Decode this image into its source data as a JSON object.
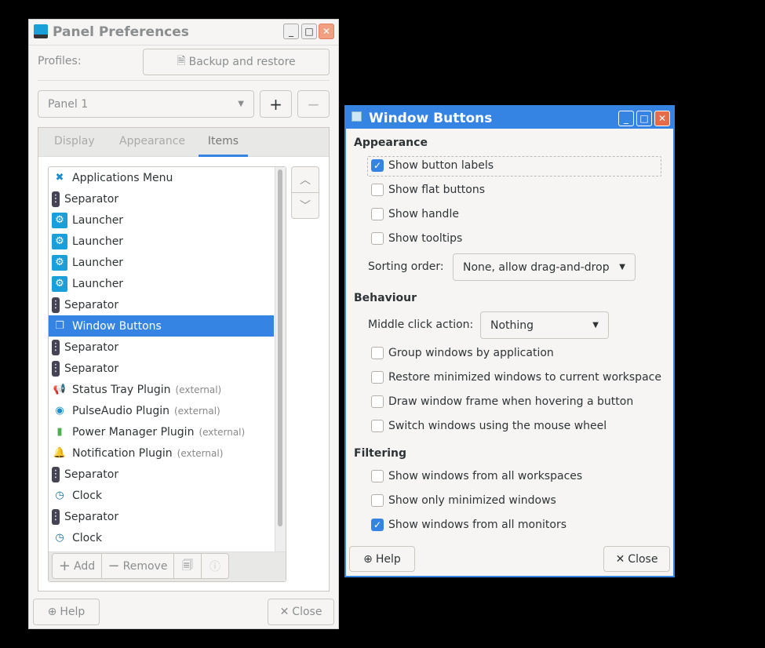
{
  "panel_prefs": {
    "title": "Panel Preferences",
    "profiles_label": "Profiles:",
    "backup_button": "Backup and restore",
    "panel_select": "Panel 1",
    "add_panel": "+",
    "remove_panel": "−",
    "tabs": [
      {
        "label": "Display"
      },
      {
        "label": "Appearance"
      },
      {
        "label": "Items"
      }
    ],
    "items": [
      {
        "label": "Applications Menu",
        "ext": "",
        "icon": "applications-menu-icon"
      },
      {
        "label": "Separator",
        "ext": "",
        "icon": "separator-icon"
      },
      {
        "label": "Launcher",
        "ext": "",
        "icon": "launcher-icon"
      },
      {
        "label": "Launcher",
        "ext": "",
        "icon": "launcher-icon"
      },
      {
        "label": "Launcher",
        "ext": "",
        "icon": "launcher-icon"
      },
      {
        "label": "Launcher",
        "ext": "",
        "icon": "launcher-icon"
      },
      {
        "label": "Separator",
        "ext": "",
        "icon": "separator-icon"
      },
      {
        "label": "Window Buttons",
        "ext": "",
        "icon": "window-buttons-icon"
      },
      {
        "label": "Separator",
        "ext": "",
        "icon": "separator-icon"
      },
      {
        "label": "Separator",
        "ext": "",
        "icon": "separator-icon"
      },
      {
        "label": "Status Tray Plugin",
        "ext": "(external)",
        "icon": "status-tray-icon"
      },
      {
        "label": "PulseAudio Plugin",
        "ext": "(external)",
        "icon": "pulseaudio-icon"
      },
      {
        "label": "Power Manager Plugin",
        "ext": "(external)",
        "icon": "battery-icon"
      },
      {
        "label": "Notification Plugin",
        "ext": "(external)",
        "icon": "bell-icon"
      },
      {
        "label": "Separator",
        "ext": "",
        "icon": "separator-icon"
      },
      {
        "label": "Clock",
        "ext": "",
        "icon": "clock-icon"
      },
      {
        "label": "Separator",
        "ext": "",
        "icon": "separator-icon"
      },
      {
        "label": "Clock",
        "ext": "",
        "icon": "clock-icon"
      }
    ],
    "add": "Add",
    "remove": "Remove",
    "help": "Help",
    "close": "Close"
  },
  "window_buttons": {
    "title": "Window Buttons",
    "appearance": "Appearance",
    "show_button_labels": "Show button labels",
    "show_flat_buttons": "Show flat buttons",
    "show_handle": "Show handle",
    "show_tooltips": "Show tooltips",
    "sorting_label": "Sorting order:",
    "sorting_value": "None, allow drag-and-drop",
    "behaviour": "Behaviour",
    "middle_label": "Middle click action:",
    "middle_value": "Nothing",
    "group": "Group windows by application",
    "restore": "Restore minimized windows to current workspace",
    "draw_frame": "Draw window frame when hovering a button",
    "switch_wheel": "Switch windows using the mouse wheel",
    "filtering": "Filtering",
    "all_workspaces": "Show windows from all workspaces",
    "only_minimized": "Show only minimized windows",
    "all_monitors": "Show windows from all monitors",
    "help": "Help",
    "close": "Close"
  },
  "colors": {
    "accent": "#3584e4",
    "close": "#e66b4a"
  }
}
